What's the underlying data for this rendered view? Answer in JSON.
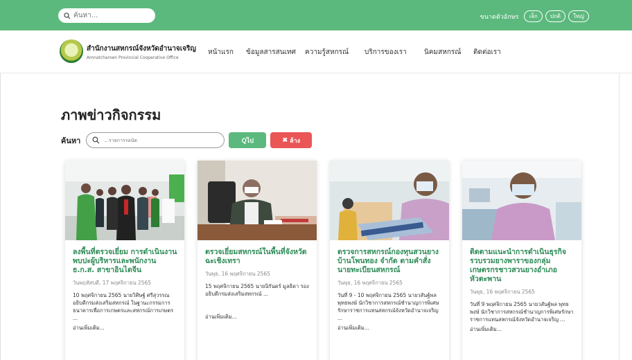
{
  "topbar": {
    "search_placeholder": "ค้นหา...",
    "font_size_label": "ขนาดตัวอักษร",
    "font_sizes": [
      "เล็ก",
      "ปกติ",
      "ใหญ่"
    ]
  },
  "header": {
    "org_name_th": "สำนักงานสหกรณ์จังหวัดอำนาจเจริญ",
    "org_name_en": "Amnatcharoen Provincial Cooperative Office",
    "nav": [
      "หน้าแรก",
      "ข้อมูลสารสนเทศ",
      "ความรู้สหกรณ์",
      "บริการของเรา",
      "นิคมสหกรณ์",
      "ติดต่อเรา"
    ]
  },
  "page": {
    "title": "ภาพข่าวกิจกรรม",
    "search_label": "ค้นหา",
    "search_placeholder": "...รายการรอนัด",
    "go_label": "Qไป",
    "clear_label": "ล้าง"
  },
  "cards": [
    {
      "title": "ลงพื้นที่ตรวจเยี่ยม การดำเนินงาน พบปะผู้บริหารและพนักงาน ธ.ก.ส. สาขาอินไดจีน",
      "date": "วันพฤหัสบดี, 17 พฤศจิกายน 2565",
      "desc": "10 พฤศจิกายน 2565 นายวิศิษฐ์ ศรีสุวรรณ อธิบดีกรมส่งเสริมสหกรณ์ ในฐานะกรรมการธนาคารเพื่อการเกษตรและสหกรณ์การเกษตร ...",
      "more": "อ่านเพิ่มเติม..."
    },
    {
      "title": "ตรวจเยี่ยมสหกรณ์ในพื้นที่จังหวัดฉะเชิงเทรา",
      "date": "วันพุธ, 16 พฤศจิกายน 2565",
      "desc": "15 พฤศจิกายน 2565 นายนิรันดร์ มูลธิดา รองอธิบดีกรมส่งเสริมสหกรณ์ ...",
      "more": "อ่านเพิ่มเติม..."
    },
    {
      "title": "ตรวจการสหกรณ์กองทุนสวนยางบ้านโพนทอง จำกัด ตามคำสั่งนายทะเบียนสหกรณ์",
      "date": "วันพุธ, 16 พฤศจิกายน 2565",
      "desc": "วันที่ 9 - 10 พฤศจิกายน 2565 นายวสันฐ์พล พุทธพงษ์ นักวิชาการสหกรณ์ชำนาญการพิเศษ รักษาราชการแทนสหกรณ์จังหวัดอำนาจเจริญ ...",
      "more": "อ่านเพิ่มเติม..."
    },
    {
      "title": "ติดตามแนะนำการดำเนินธุรกิจรวบรวมยางพาราของกลุ่มเกษตรกรชาวสวนยางอำเภอหัวตะพาน",
      "date": "วันพุธ, 16 พฤศจิกายน 2565",
      "desc": "วันที่ 9 พฤศจิกายน 2565 นายวสันฐ์พล พุทธพงษ์ นักวิชาการสหกรณ์ชำนาญการพิเศษรักษาราชการแทนสหกรณ์จังหวัดอำนาจเจริญ ...",
      "more": "อ่านเพิ่มเติม..."
    }
  ]
}
